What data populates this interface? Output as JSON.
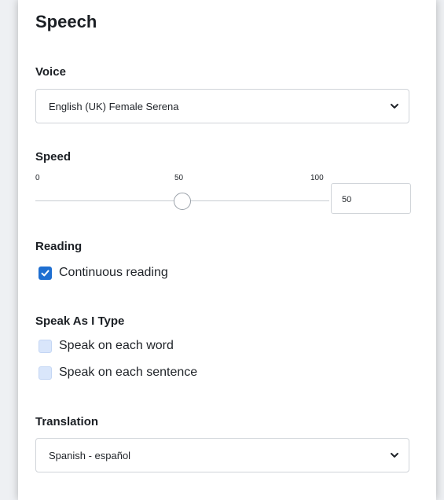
{
  "title": "Speech",
  "voice": {
    "label": "Voice",
    "selected": "English (UK) Female Serena"
  },
  "speed": {
    "label": "Speed",
    "tick_min": "0",
    "tick_mid": "50",
    "tick_max": "100",
    "value": 50,
    "input_value": "50"
  },
  "reading": {
    "label": "Reading",
    "continuous_label": "Continuous reading",
    "continuous_checked": true
  },
  "speak_as_i_type": {
    "label": "Speak As I Type",
    "word_label": "Speak on each word",
    "word_checked": false,
    "sentence_label": "Speak on each sentence",
    "sentence_checked": false
  },
  "translation": {
    "label": "Translation",
    "selected": "Spanish - español"
  },
  "colors": {
    "accent": "#1f6fd1",
    "unchecked_fill": "#d9e6fb"
  },
  "icons": {
    "dropdown": "chevron-down-icon",
    "check": "checkmark-icon"
  }
}
